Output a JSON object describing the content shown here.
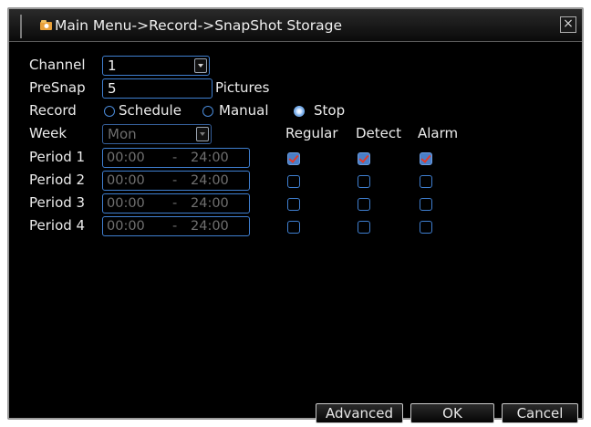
{
  "window": {
    "title": "Main Menu->Record->SnapShot Storage",
    "close_glyph": "×"
  },
  "form": {
    "channel": {
      "label": "Channel",
      "value": "1"
    },
    "presnap": {
      "label": "PreSnap",
      "value": "5",
      "unit": "Pictures"
    },
    "record": {
      "label": "Record",
      "options": [
        {
          "label": "Schedule",
          "selected": false
        },
        {
          "label": "Manual",
          "selected": false
        },
        {
          "label": "Stop",
          "selected": true
        }
      ]
    },
    "week": {
      "label": "Week",
      "value": "Mon"
    },
    "columns": [
      "Regular",
      "Detect",
      "Alarm"
    ],
    "periods": [
      {
        "label": "Period 1",
        "start": "00:00",
        "sep": "-",
        "end": "24:00",
        "regular": true,
        "detect": true,
        "alarm": true
      },
      {
        "label": "Period 2",
        "start": "00:00",
        "sep": "-",
        "end": "24:00",
        "regular": false,
        "detect": false,
        "alarm": false
      },
      {
        "label": "Period 3",
        "start": "00:00",
        "sep": "-",
        "end": "24:00",
        "regular": false,
        "detect": false,
        "alarm": false
      },
      {
        "label": "Period 4",
        "start": "00:00",
        "sep": "-",
        "end": "24:00",
        "regular": false,
        "detect": false,
        "alarm": false
      }
    ]
  },
  "buttons": {
    "advanced": "Advanced",
    "ok": "OK",
    "cancel": "Cancel"
  },
  "colors": {
    "accent_border": "#3f7fd0",
    "check_mark": "#e23a2a",
    "background": "#000000"
  },
  "icons": {
    "title": "folder-camera-icon",
    "close": "close-icon"
  }
}
